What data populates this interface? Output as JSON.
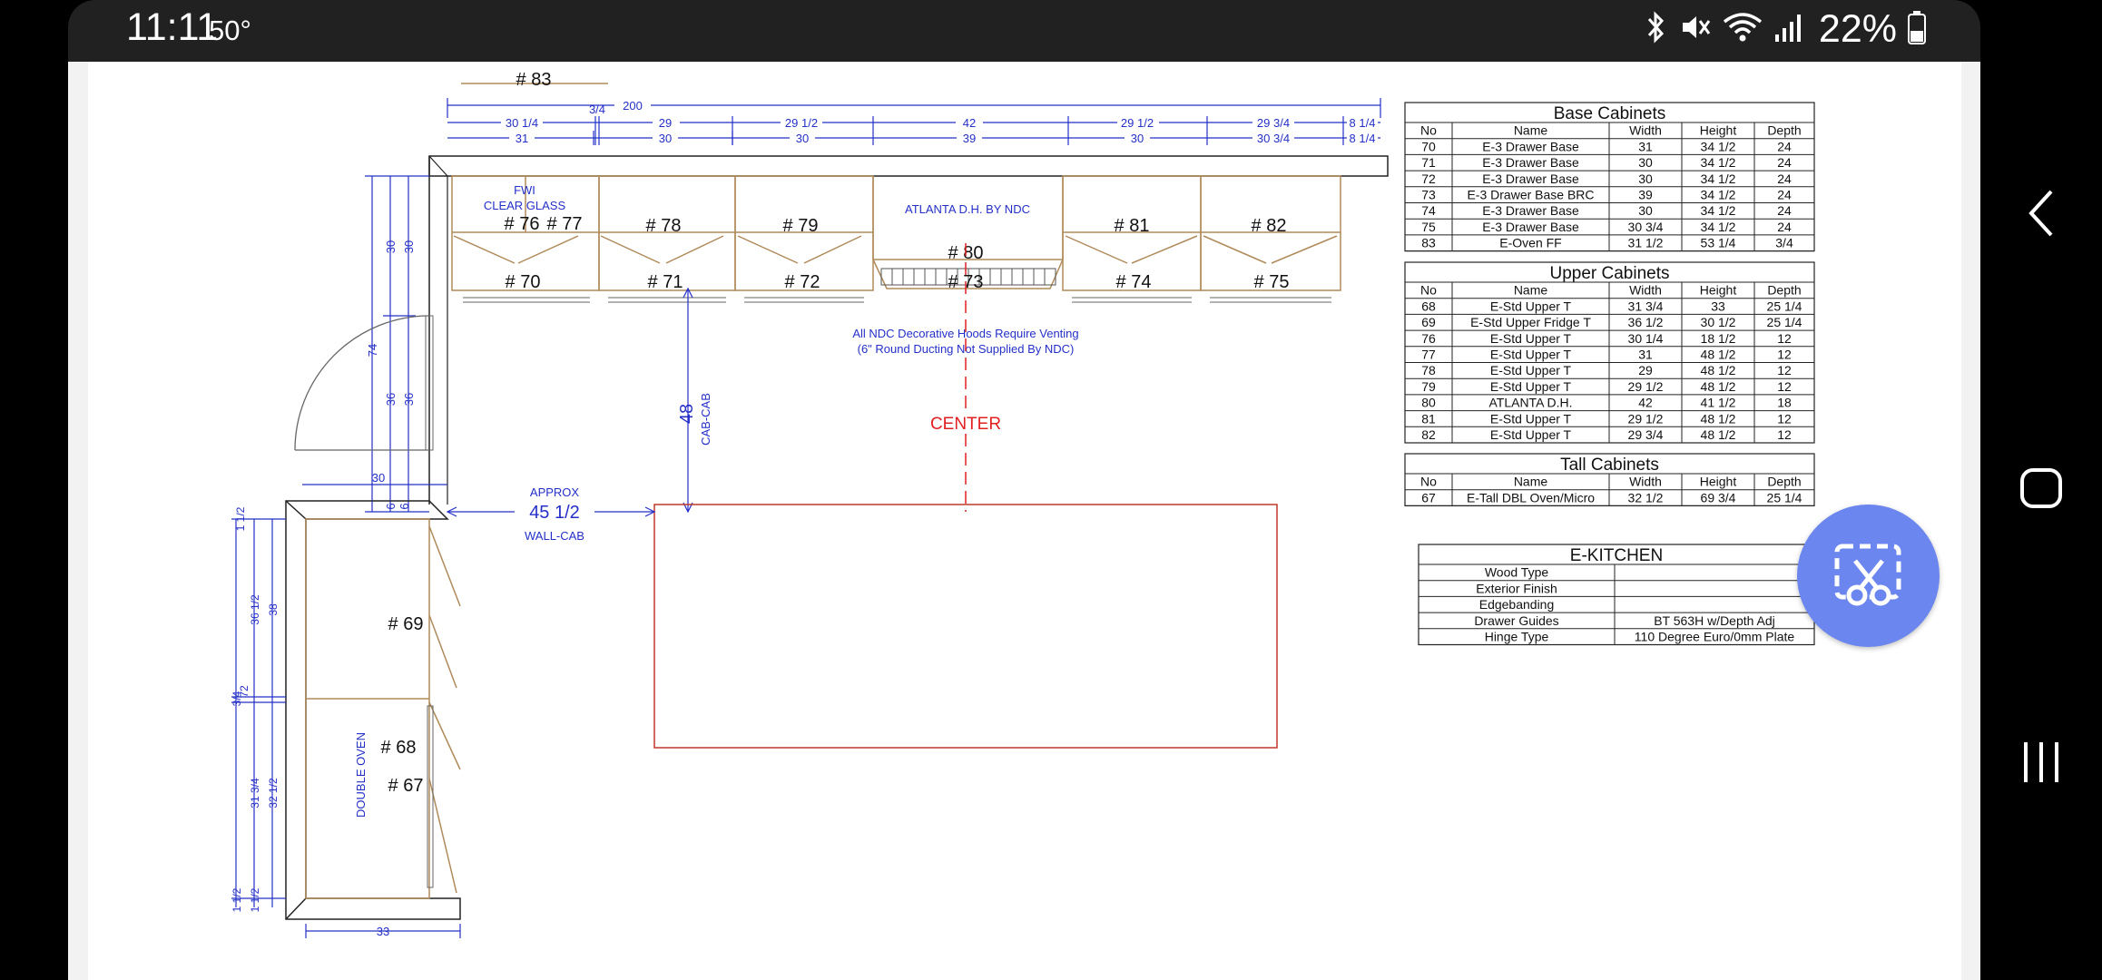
{
  "status_bar": {
    "time": "11:11",
    "temperature": "50°",
    "battery_percent": "22%",
    "icons": [
      "bluetooth-icon",
      "mute-icon",
      "wifi-icon",
      "signal-icon",
      "battery-icon"
    ]
  },
  "drawing": {
    "top_label": "# 83",
    "overall_width": "200",
    "dims_upper_row": [
      "30 1/4",
      "3/4",
      "29",
      "29 1/2",
      "42",
      "29 1/2",
      "29 3/4",
      "8 1/4"
    ],
    "dims_base_row": [
      "31",
      "30",
      "30",
      "39",
      "30",
      "30 3/4",
      "8 1/4"
    ],
    "fwi_note": "FWI",
    "clear_glass_note": "CLEAR GLASS",
    "upper_labels": [
      "# 76",
      "# 77",
      "# 78",
      "# 79",
      "# 80",
      "# 81",
      "# 82"
    ],
    "hood_label": "ATLANTA D.H. BY NDC",
    "base_labels": [
      "# 70",
      "# 71",
      "# 72",
      "# 73",
      "# 74",
      "# 75"
    ],
    "hood_note_line1": "All NDC Decorative Hoods Require Venting",
    "hood_note_line2": "(6\" Round Ducting Not Supplied By NDC)",
    "center_label": "CENTER",
    "cab_cab_dim": "48",
    "cab_cab_label": "CAB-CAB",
    "approx_label": "APPROX",
    "approx_dim": "45 1/2",
    "wall_cab_label": "WALL-CAB",
    "left_dims_outer": [
      "30",
      "74",
      "36"
    ],
    "left_dims_inner": [
      "30",
      "36"
    ],
    "left_dim_30": "30",
    "left_dims_small": [
      "6",
      "6"
    ],
    "tall_dims_a": [
      "1 1/2",
      "36 1/2",
      "3/4",
      "31 3/4",
      "1 1/2"
    ],
    "tall_dims_b": [
      "38",
      "72",
      "32 1/2",
      "1 1/2"
    ],
    "tall_labels": [
      "# 69",
      "# 68",
      "# 67"
    ],
    "double_oven_label": "DOUBLE OVEN",
    "tall_width_dim": "33"
  },
  "tables": {
    "headers": [
      "No",
      "Name",
      "Width",
      "Height",
      "Depth"
    ],
    "base": {
      "title": "Base Cabinets",
      "rows": [
        [
          "70",
          "E-3 Drawer Base",
          "31",
          "34 1/2",
          "24"
        ],
        [
          "71",
          "E-3 Drawer Base",
          "30",
          "34 1/2",
          "24"
        ],
        [
          "72",
          "E-3 Drawer Base",
          "30",
          "34 1/2",
          "24"
        ],
        [
          "73",
          "E-3 Drawer Base BRC",
          "39",
          "34 1/2",
          "24"
        ],
        [
          "74",
          "E-3 Drawer Base",
          "30",
          "34 1/2",
          "24"
        ],
        [
          "75",
          "E-3 Drawer Base",
          "30 3/4",
          "34 1/2",
          "24"
        ],
        [
          "83",
          "E-Oven FF",
          "31 1/2",
          "53 1/4",
          "3/4"
        ]
      ]
    },
    "upper": {
      "title": "Upper Cabinets",
      "rows": [
        [
          "68",
          "E-Std Upper T",
          "31 3/4",
          "33",
          "25 1/4"
        ],
        [
          "69",
          "E-Std Upper Fridge T",
          "36 1/2",
          "30 1/2",
          "25 1/4"
        ],
        [
          "76",
          "E-Std Upper T",
          "30 1/4",
          "18 1/2",
          "12"
        ],
        [
          "77",
          "E-Std Upper T",
          "31",
          "48 1/2",
          "12"
        ],
        [
          "78",
          "E-Std Upper T",
          "29",
          "48 1/2",
          "12"
        ],
        [
          "79",
          "E-Std Upper T",
          "29 1/2",
          "48 1/2",
          "12"
        ],
        [
          "80",
          "ATLANTA D.H.",
          "42",
          "41 1/2",
          "18"
        ],
        [
          "81",
          "E-Std Upper T",
          "29 1/2",
          "48 1/2",
          "12"
        ],
        [
          "82",
          "E-Std Upper T",
          "29 3/4",
          "48 1/2",
          "12"
        ]
      ]
    },
    "tall": {
      "title": "Tall Cabinets",
      "rows": [
        [
          "67",
          "E-Tall DBL Oven/Micro",
          "32 1/2",
          "69 3/4",
          "25 1/4"
        ]
      ]
    },
    "kitchen": {
      "title": "E-KITCHEN",
      "rows": [
        [
          "Wood Type",
          ""
        ],
        [
          "Exterior Finish",
          ""
        ],
        [
          "Edgebanding",
          ""
        ],
        [
          "Drawer Guides",
          "BT 563H w/Depth Adj"
        ],
        [
          "Hinge Type",
          "110 Degree Euro/0mm Plate"
        ]
      ]
    }
  },
  "nav": {
    "icons": [
      "back-icon",
      "home-icon",
      "recents-icon"
    ]
  },
  "colors": {
    "dim_blue": "#2430c8",
    "cabinet_brown": "#b08a5a",
    "island_red": "#c0392b",
    "center_red": "#e02020",
    "fab_blue": "#6b86ee"
  }
}
